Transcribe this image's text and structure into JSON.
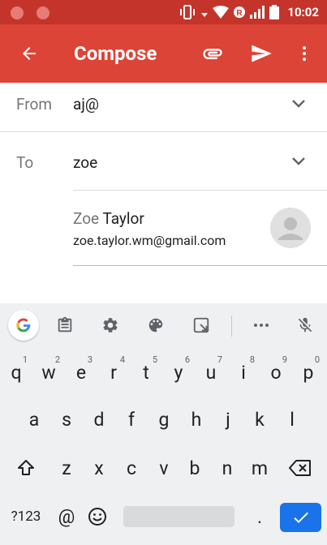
{
  "status_bar": {
    "time": "10:02"
  },
  "app_bar": {
    "back_icon": "arrow-back-icon",
    "title": "Compose",
    "attach_icon": "paperclip-icon",
    "send_icon": "send-icon",
    "more_icon": "more-vert-icon"
  },
  "from": {
    "label": "From",
    "value": "aj@"
  },
  "to": {
    "label": "To",
    "value": "zoe"
  },
  "suggestion": {
    "name_match": "Zoe",
    "name_rest": " Taylor",
    "email": "zoe.taylor.wm@gmail.com"
  },
  "keyboard": {
    "row1": [
      {
        "k": "q",
        "n": "1"
      },
      {
        "k": "w",
        "n": "2"
      },
      {
        "k": "e",
        "n": "3"
      },
      {
        "k": "r",
        "n": "4"
      },
      {
        "k": "t",
        "n": "5"
      },
      {
        "k": "y",
        "n": "6"
      },
      {
        "k": "u",
        "n": "7"
      },
      {
        "k": "i",
        "n": "8"
      },
      {
        "k": "o",
        "n": "9"
      },
      {
        "k": "p",
        "n": "0"
      }
    ],
    "row2": [
      "a",
      "s",
      "d",
      "f",
      "g",
      "h",
      "j",
      "k",
      "l"
    ],
    "row3": [
      "z",
      "x",
      "c",
      "v",
      "b",
      "n",
      "m"
    ],
    "symbols_label": "?123",
    "at": "@",
    "period": "."
  },
  "colors": {
    "app_bar": "#db4437",
    "status_bar": "#c5342a",
    "accent": "#1a73e8"
  }
}
